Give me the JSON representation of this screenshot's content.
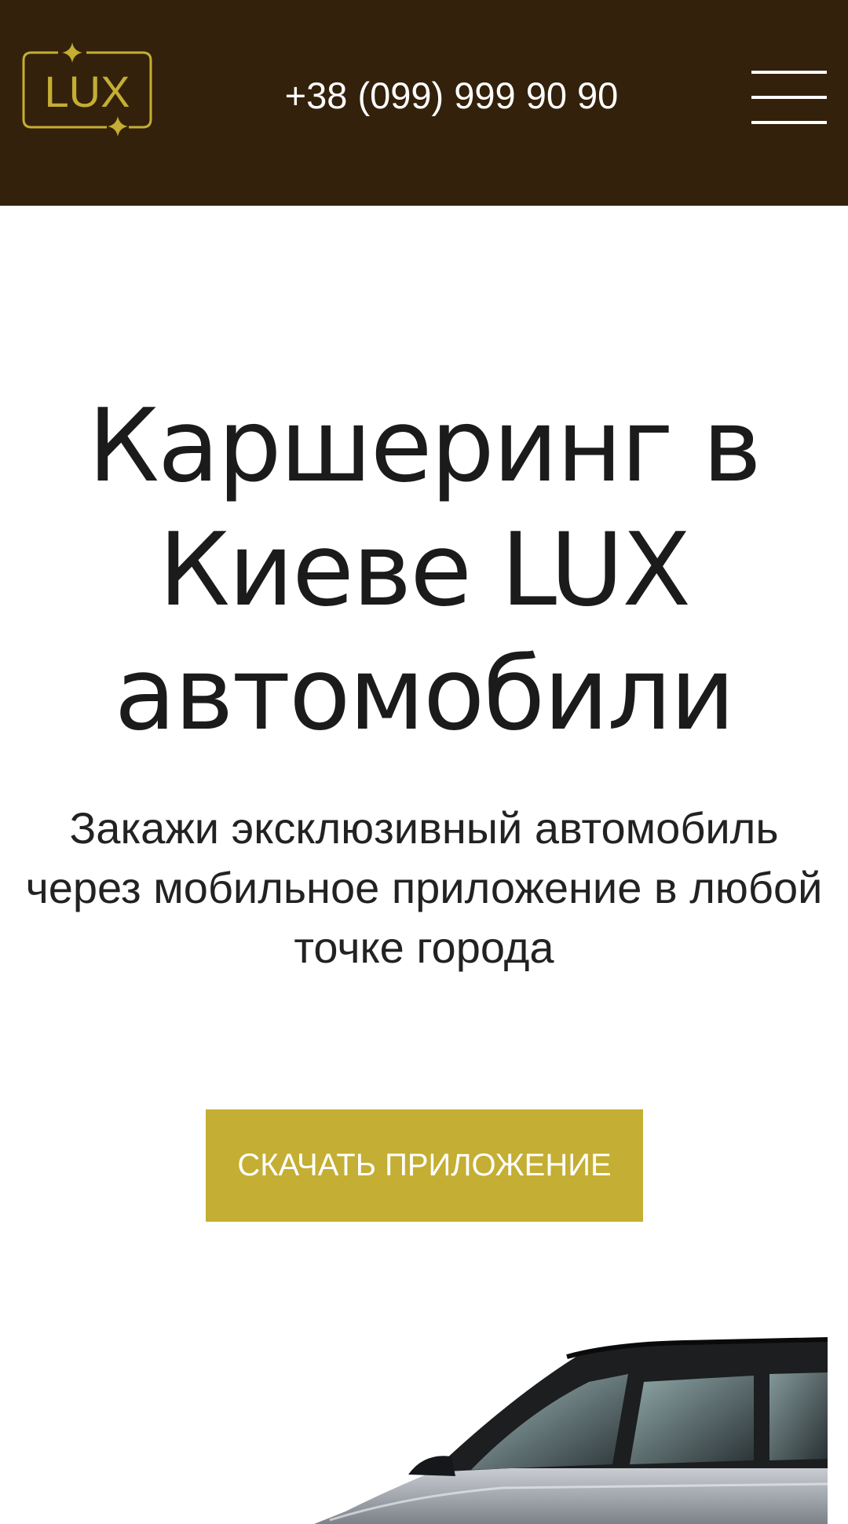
{
  "header": {
    "logo_text": "LUX",
    "phone": "+38 (099) 999 90 90",
    "menu_icon": "hamburger-menu-icon"
  },
  "hero": {
    "title": "Каршеринг в Киеве LUX автомобили",
    "subtitle": "Закажи эксклюзивный автомобиль через мобильное приложение в любой точке города",
    "cta_label": "СКАЧАТЬ ПРИЛОЖЕНИЕ"
  },
  "colors": {
    "header_bg": "#33210b",
    "accent_gold": "#c4ae33",
    "text_dark": "#1b1b1b",
    "white": "#ffffff"
  },
  "images": {
    "car": "luxury-car-image"
  }
}
